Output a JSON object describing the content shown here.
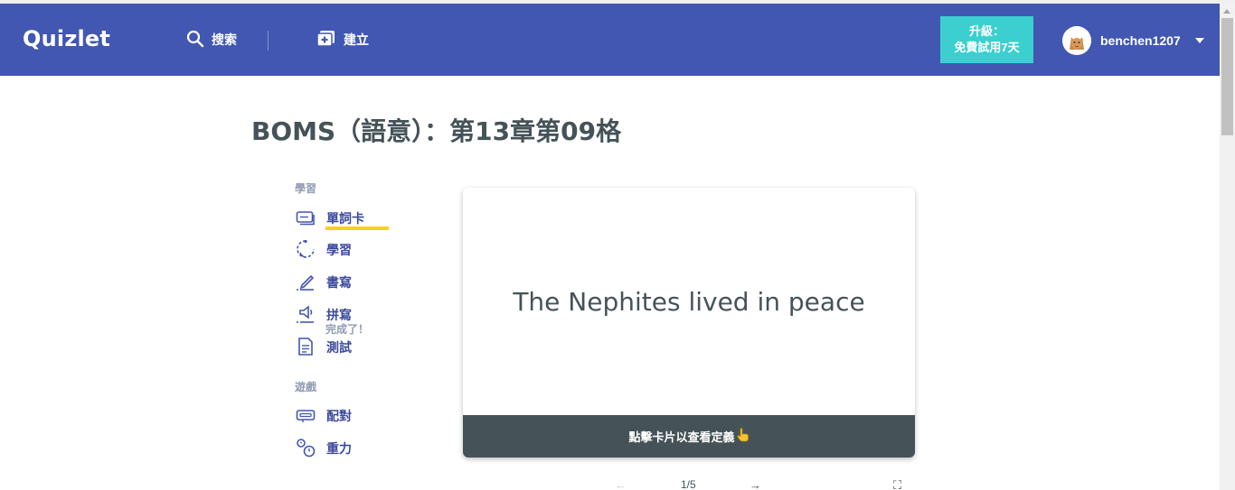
{
  "header": {
    "logo": "Quizlet",
    "search_label": "搜索",
    "create_label": "建立",
    "upgrade_line1": "升級：",
    "upgrade_line2": "免費試用7天",
    "username": "benchen1207"
  },
  "title": "BOMS（語意）：第13章第09格",
  "sidebar": {
    "study_section": "學習",
    "games_section": "遊戲",
    "items": [
      {
        "label": "單詞卡",
        "icon": "flashcards-icon"
      },
      {
        "label": "學習",
        "icon": "learn-icon"
      },
      {
        "label": "書寫",
        "icon": "write-icon"
      },
      {
        "label": "拼寫",
        "icon": "spell-icon"
      },
      {
        "label": "測試",
        "icon": "test-icon"
      },
      {
        "label": "配對",
        "icon": "match-icon"
      },
      {
        "label": "重力",
        "icon": "gravity-icon"
      }
    ],
    "spell_done": "完成了！"
  },
  "card": {
    "term": "The Nephites lived in peace",
    "footer": "點擊卡片以查看定義",
    "footer_icon": "pointer-hand-icon"
  },
  "controls": {
    "counter": "1/5"
  },
  "colors": {
    "brand": "#4257b2",
    "upgrade": "#3ccfcf",
    "active_underline": "#ffcd1f",
    "card_footer": "#455358"
  }
}
